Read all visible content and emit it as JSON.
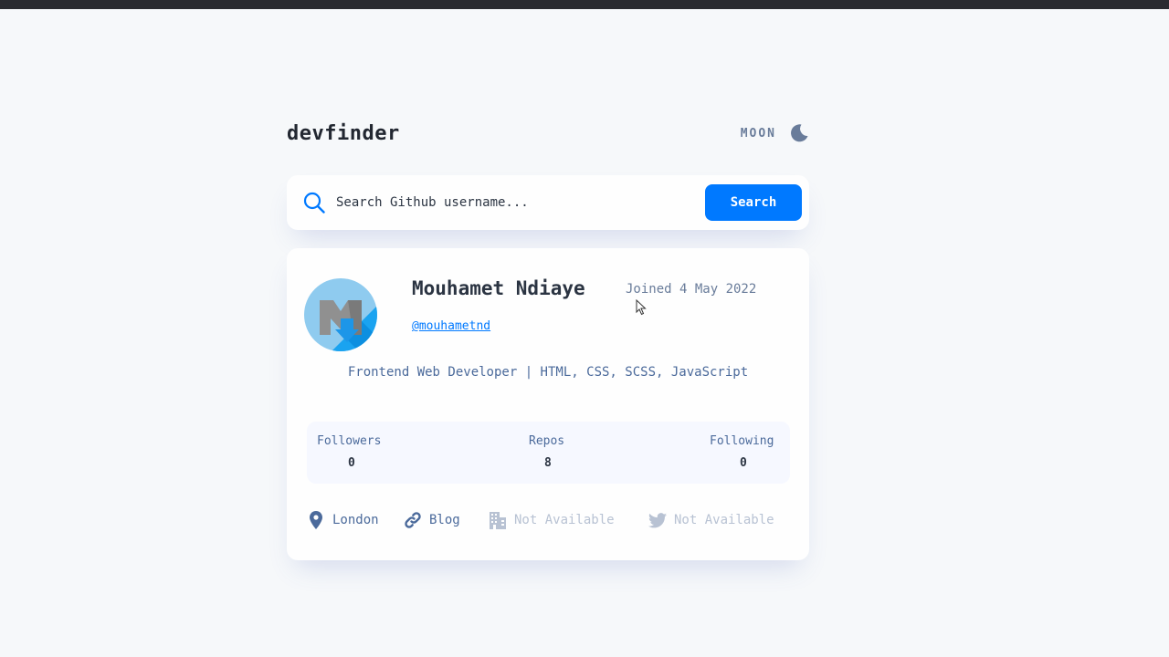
{
  "app": {
    "logo": "devfinder"
  },
  "theme": {
    "label": "MOON",
    "icon": "moon-icon"
  },
  "search": {
    "placeholder": "Search Github username...",
    "button_label": "Search",
    "icon": "search-icon"
  },
  "profile": {
    "name": "Mouhamet Ndiaye",
    "joined": "Joined 4 May 2022",
    "login": "@mouhametnd",
    "bio": "Frontend Web Developer | HTML, CSS, SCSS, JavaScript"
  },
  "stats": [
    {
      "label": "Followers",
      "value": "0"
    },
    {
      "label": "Repos",
      "value": "8"
    },
    {
      "label": "Following",
      "value": "0"
    }
  ],
  "links": [
    {
      "label": "London",
      "icon": "location-pin-icon",
      "available": true
    },
    {
      "label": "Blog",
      "icon": "link-icon",
      "available": true
    },
    {
      "label": "Not Available",
      "icon": "company-building-icon",
      "available": false
    },
    {
      "label": "Not Available",
      "icon": "twitter-icon",
      "available": false
    }
  ],
  "colors": {
    "accent": "#0079ff",
    "background": "#f6f8fa",
    "card": "#fefefe",
    "heading": "#2b3442",
    "muted": "#697c9a",
    "unavailable": "#b8c2d3"
  }
}
